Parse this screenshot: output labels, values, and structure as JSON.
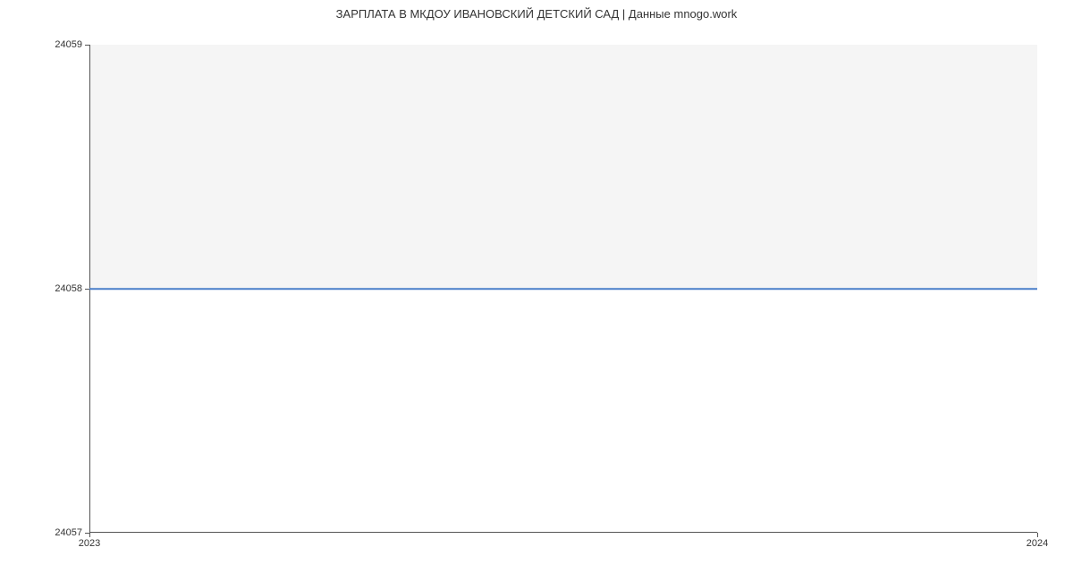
{
  "chart_data": {
    "type": "line",
    "title": "ЗАРПЛАТА В МКДОУ ИВАНОВСКИЙ ДЕТСКИЙ САД | Данные mnogo.work",
    "x": [
      2023,
      2024
    ],
    "values": [
      24058,
      24058
    ],
    "xlabel": "",
    "ylabel": "",
    "xlim": [
      2023,
      2024
    ],
    "ylim": [
      24057,
      24059
    ],
    "y_ticks": [
      24057,
      24058,
      24059
    ],
    "x_ticks": [
      2023,
      2024
    ],
    "series_color": "#4a7ec9"
  }
}
